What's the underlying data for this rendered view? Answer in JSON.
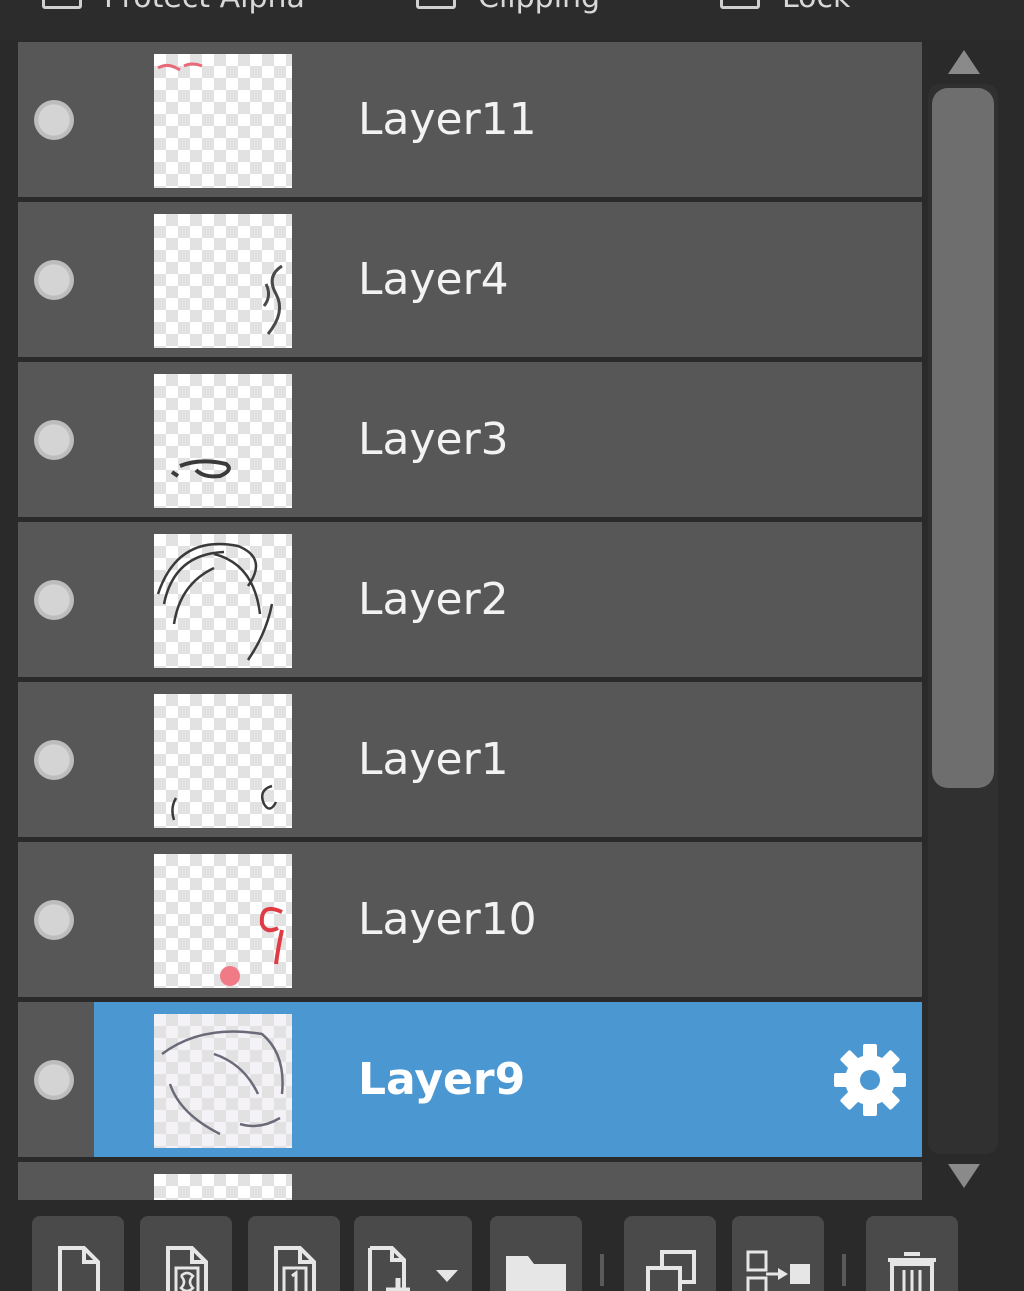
{
  "top_options": [
    {
      "label": "Protect Alpha",
      "checked": false
    },
    {
      "label": "Clipping",
      "checked": false
    },
    {
      "label": "Lock",
      "checked": false
    }
  ],
  "layers": [
    {
      "name": "Layer11",
      "visible": true,
      "selected": false
    },
    {
      "name": "Layer4",
      "visible": true,
      "selected": false
    },
    {
      "name": "Layer3",
      "visible": true,
      "selected": false
    },
    {
      "name": "Layer2",
      "visible": true,
      "selected": false
    },
    {
      "name": "Layer1",
      "visible": true,
      "selected": false
    },
    {
      "name": "Layer10",
      "visible": true,
      "selected": false
    },
    {
      "name": "Layer9",
      "visible": true,
      "selected": true
    }
  ],
  "toolbar": {
    "buttons": [
      {
        "icon": "new-layer-icon"
      },
      {
        "icon": "new-8bit-layer-icon"
      },
      {
        "icon": "new-1bit-layer-icon"
      },
      {
        "icon": "add-layer-menu-icon"
      },
      {
        "icon": "new-folder-icon"
      },
      {
        "icon": "duplicate-layer-icon"
      },
      {
        "icon": "merge-layer-icon"
      },
      {
        "icon": "delete-layer-icon"
      }
    ]
  },
  "colors": {
    "selected": "#4b97d2",
    "row": "#575757",
    "panel": "#2a2a2a"
  }
}
